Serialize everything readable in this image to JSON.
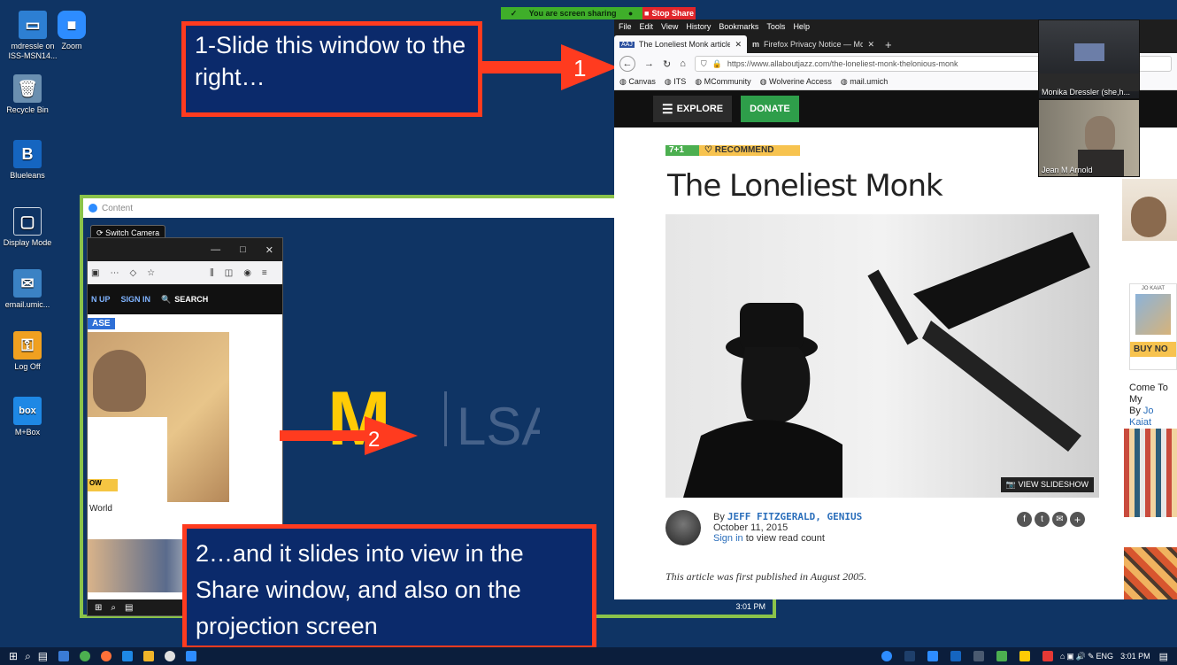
{
  "desktop_icons": [
    {
      "label": "mdressle on ISS-MSN14...",
      "icon": "computer-icon"
    },
    {
      "label": "Zoom",
      "icon": "zoom-icon"
    },
    {
      "label": "Recycle Bin",
      "icon": "recycle-bin-icon"
    },
    {
      "label": "Blueleans",
      "icon": "bluejeans-icon"
    },
    {
      "label": "Display Mode",
      "icon": "display-mode-icon"
    },
    {
      "label": "email.umic...",
      "icon": "email-icon"
    },
    {
      "label": "Log Off",
      "icon": "key-icon"
    },
    {
      "label": "M+Box",
      "icon": "box-icon"
    }
  ],
  "share_banner": {
    "status": "You are screen sharing",
    "stop": "Stop Share"
  },
  "callouts": {
    "step1": "1-Slide this window to the right…",
    "step2": "2…and it slides into view in the Share window, and also on the projection screen"
  },
  "arrows": {
    "one": "1",
    "two": "2"
  },
  "content_window": {
    "title": "Content",
    "switch_camera": "Switch Camera",
    "mini_browser": {
      "nav": [
        "N UP",
        "SIGN IN",
        "SEARCH"
      ],
      "badge": "ASE",
      "caption": "World",
      "ow": "OW",
      "time": "3:01 PM"
    },
    "logo_letter": "M",
    "logo_text": "LSA"
  },
  "firefox": {
    "menu": [
      "File",
      "Edit",
      "View",
      "History",
      "Bookmarks",
      "Tools",
      "Help"
    ],
    "tabs": [
      {
        "title": "The Loneliest Monk article @ A",
        "active": true
      },
      {
        "title": "Firefox Privacy Notice — Mozil",
        "active": false
      }
    ],
    "new_tab": "+",
    "url": "https://www.allaboutjazz.com/the-loneliest-monk-thelonious-monk",
    "bookmarks": [
      "Canvas",
      "ITS",
      "MCommunity",
      "Wolverine Access",
      "mail.umich"
    ],
    "site": {
      "explore": "EXPLORE",
      "donate": "DONATE",
      "rec_count": "7+1",
      "recommend": "RECOMMEND",
      "article_title": "The Loneliest Monk",
      "view_slideshow": "VIEW SLIDESHOW",
      "byline_prefix": "By",
      "author": "JEFF FITZGERALD, GENIUS",
      "date": "October 11, 2015",
      "sign_in": "Sign in",
      "sign_in_suffix": "to view read count",
      "first_published": "This article was first published in August 2005.",
      "sidebar_buy": "BUY NO",
      "sidebar_title": "Come To My",
      "sidebar_by": "By",
      "sidebar_author": "Jo Kaiat",
      "sidebar_mini": "JO KAIAT"
    }
  },
  "video_tiles": [
    {
      "name": "Monika Dressler (she,h..."
    },
    {
      "name": "Jean M Arnold"
    }
  ],
  "taskbar": {
    "lang": "ENG",
    "time": "3:01 PM"
  },
  "colors": {
    "desktop_bg": "#0f3464",
    "callout_border": "#ff3b1f",
    "callout_bg": "#0b2a6b",
    "share_green": "#3fae2a",
    "stop_red": "#e0262b",
    "donate_green": "#2e9e4a",
    "umich_maize": "#ffcb05",
    "link_blue": "#2a6ebb"
  }
}
